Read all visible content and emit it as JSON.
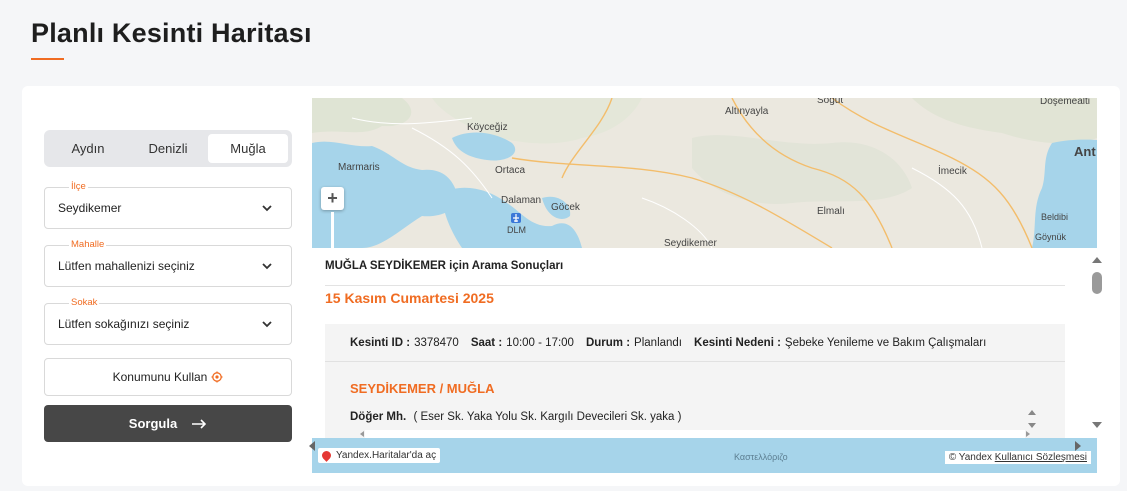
{
  "page": {
    "title": "Planlı Kesinti Haritası"
  },
  "tabs": [
    {
      "label": "Aydın",
      "active": false
    },
    {
      "label": "Denizli",
      "active": false
    },
    {
      "label": "Muğla",
      "active": true
    }
  ],
  "filters": {
    "district": {
      "label": "İlçe",
      "value": "Seydikemer"
    },
    "neighborhood": {
      "label": "Mahalle",
      "value": "Lütfen mahallenizi seçiniz"
    },
    "street": {
      "label": "Sokak",
      "value": "Lütfen sokağınızı seçiniz"
    }
  },
  "buttons": {
    "use_location": "Konumunu Kullan",
    "query": "Sorgula"
  },
  "map": {
    "labels": [
      "Altınyayla",
      "Söğüt",
      "Döşemealti",
      "Köyceğiz",
      "Marmaris",
      "Ortaca",
      "Ant",
      "Dalaman",
      "Göcek",
      "DLM",
      "İmecik",
      "Elmalı",
      "Beldibi",
      "Göynük",
      "Seydikemer"
    ],
    "yandex_chip": "Yandex.Haritalar'da aç",
    "sea_label": "Καστελλόριζο",
    "attribution": "© Yandex",
    "terms": "Kullanıcı Sözleşmesi"
  },
  "results": {
    "header": "MUĞLA SEYDİKEMER için Arama Sonuçları",
    "date": "15 Kasım Cumartesi 2025",
    "outage": {
      "id_label": "Kesinti ID :",
      "id_value": "3378470",
      "time_label": "Saat :",
      "time_value": "10:00 - 17:00",
      "status_label": "Durum :",
      "status_value": "Planlandı",
      "reason_label": "Kesinti Nedeni :",
      "reason_value": "Şebeke Yenileme ve Bakım Çalışmaları",
      "region": "SEYDİKEMER / MUĞLA",
      "street_name": "Döğer Mh.",
      "street_detail": "( Eser Sk. Yaka Yolu Sk. Kargılı Devecileri Sk. yaka )"
    }
  },
  "colors": {
    "accent": "#f06c22",
    "button_dark": "#474747",
    "sea": "#a6d4ea"
  }
}
